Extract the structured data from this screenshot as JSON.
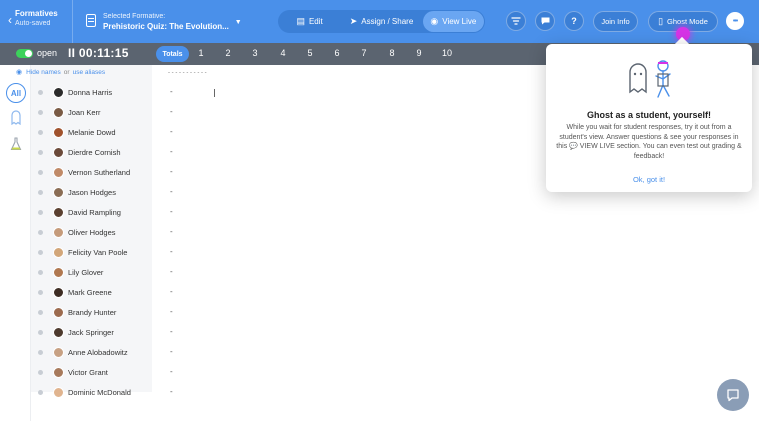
{
  "header": {
    "back_label": "Formatives",
    "back_sub": "Auto-saved",
    "formative_label": "Selected Formative:",
    "formative_name": "Prehistoric Quiz: The Evolution...",
    "modes": [
      {
        "label": "Edit",
        "icon": "edit-icon"
      },
      {
        "label": "Assign / Share",
        "icon": "send-icon"
      },
      {
        "label": "View Live",
        "icon": "chat-icon"
      }
    ],
    "join_info": "Join Info",
    "ghost_mode": "Ghost Mode",
    "more": "•••"
  },
  "session": {
    "status": "open",
    "timer": "II 00:11:15",
    "totals_label": "Totals",
    "questions": [
      "1",
      "2",
      "3",
      "4",
      "5",
      "6",
      "7",
      "8",
      "9",
      "10"
    ]
  },
  "sidebar": {
    "all_label": "All"
  },
  "students": {
    "hide_names": "Hide names",
    "or": "or",
    "use_aliases": "use aliases",
    "top_dashes": "-      -      -      -      -      -      -      -      -      -      -",
    "list": [
      {
        "name": "Donna Harris",
        "score": "-"
      },
      {
        "name": "Joan Kerr",
        "score": "-"
      },
      {
        "name": "Melanie Dowd",
        "score": "-"
      },
      {
        "name": "Dierdre Cornish",
        "score": "-"
      },
      {
        "name": "Vernon Sutherland",
        "score": "-"
      },
      {
        "name": "Jason Hodges",
        "score": "-"
      },
      {
        "name": "David Rampling",
        "score": "-"
      },
      {
        "name": "Oliver Hodges",
        "score": "-"
      },
      {
        "name": "Felicity Van Poole",
        "score": "-"
      },
      {
        "name": "Lily Glover",
        "score": "-"
      },
      {
        "name": "Mark Greene",
        "score": "-"
      },
      {
        "name": "Brandy Hunter",
        "score": "-"
      },
      {
        "name": "Jack Springer",
        "score": "-"
      },
      {
        "name": "Anne Alobadowitz",
        "score": "-"
      },
      {
        "name": "Victor Grant",
        "score": "-"
      },
      {
        "name": "Dominic McDonald",
        "score": "-"
      }
    ]
  },
  "popup": {
    "title": "Ghost as a student, yourself!",
    "body": "While you wait for student responses, try it out from a student's view. Answer questions & see your responses in this 💬 VIEW LIVE section. You can even test out grading & feedback!",
    "link": "Ok, got it!"
  },
  "colors": {
    "header": "#4a90ea",
    "bar2": "#5b6470",
    "accent": "#4a90ea",
    "toggle": "#3cd25b",
    "ghost_highlight": "#d633e6"
  }
}
